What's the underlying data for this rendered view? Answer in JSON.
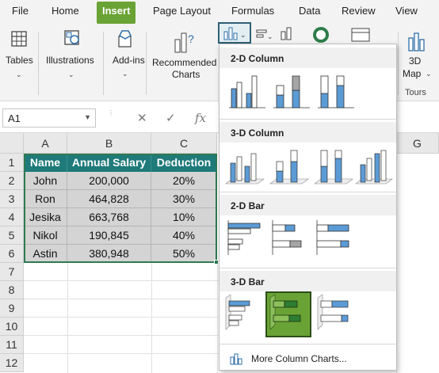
{
  "ribbon_tabs": [
    "File",
    "Home",
    "Insert",
    "Page Layout",
    "Formulas",
    "Data",
    "Review",
    "View"
  ],
  "ribbon": {
    "tables_label": "Tables",
    "illustrations_label": "Illustrations",
    "addins_label": "Add-ins",
    "recommended_line1": "Recommended",
    "recommended_line2": "Charts",
    "map_line1": "3D",
    "map_line2": "Map",
    "tours_label": "Tours"
  },
  "formula_bar": {
    "name_box": "A1",
    "cancel_symbol": "✕",
    "enter_symbol": "✓",
    "fx_symbol": "fx"
  },
  "sheet": {
    "columns": [
      "A",
      "B",
      "C",
      "G"
    ],
    "rows": [
      "1",
      "2",
      "3",
      "4",
      "5",
      "6",
      "7",
      "8",
      "9",
      "10",
      "11",
      "12"
    ],
    "header": [
      "Name",
      "Annual Salary",
      "Deduction"
    ],
    "data": [
      [
        "John",
        "200,000",
        "20%"
      ],
      [
        "Ron",
        "464,828",
        "30%"
      ],
      [
        "Jesika",
        "663,768",
        "10%"
      ],
      [
        "Nikol",
        "190,845",
        "40%"
      ],
      [
        "Astin",
        "380,948",
        "50%"
      ]
    ]
  },
  "dropdown": {
    "sections": [
      "2-D Column",
      "3-D Column",
      "2-D Bar",
      "3-D Bar"
    ],
    "more_label": "More Column Charts...",
    "selected": "3-D Bar clustered (2nd)"
  },
  "colors": {
    "active_tab": "#6aa335",
    "table_header": "#1f7a7a",
    "selection": "#2e7a52",
    "chart_blue": "#5b9bd5",
    "chart_gray": "#a5a5a5",
    "selected_chart": "#6aa335"
  }
}
